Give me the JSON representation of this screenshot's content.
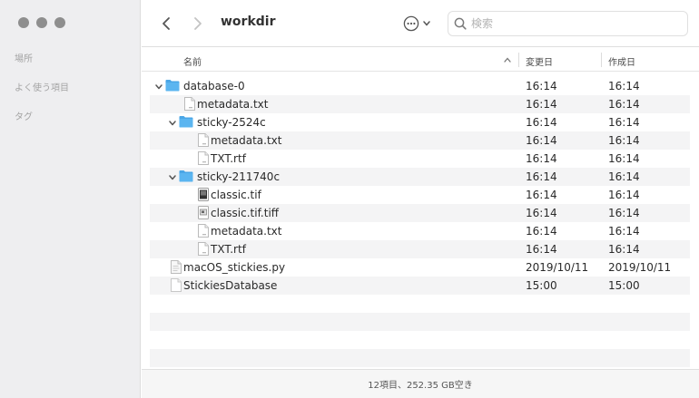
{
  "sidebar": {
    "sections": [
      "場所",
      "よく使う項目",
      "タグ"
    ]
  },
  "toolbar": {
    "title": "workdir",
    "search_placeholder": "検索"
  },
  "columns": {
    "name": "名前",
    "modified": "変更日",
    "created": "作成日"
  },
  "rows": [
    {
      "name": "database-0",
      "type": "folder",
      "level": 0,
      "expanded": true,
      "modified": "16:14",
      "created": "16:14"
    },
    {
      "name": "metadata.txt",
      "type": "text",
      "level": 1,
      "modified": "16:14",
      "created": "16:14"
    },
    {
      "name": "sticky-2524c",
      "type": "folder",
      "level": 1,
      "expanded": true,
      "modified": "16:14",
      "created": "16:14"
    },
    {
      "name": "metadata.txt",
      "type": "text",
      "level": 2,
      "modified": "16:14",
      "created": "16:14"
    },
    {
      "name": "TXT.rtf",
      "type": "text",
      "level": 2,
      "modified": "16:14",
      "created": "16:14"
    },
    {
      "name": "sticky-211740c",
      "type": "folder",
      "level": 1,
      "expanded": true,
      "modified": "16:14",
      "created": "16:14"
    },
    {
      "name": "classic.tif",
      "type": "image",
      "level": 2,
      "modified": "16:14",
      "created": "16:14"
    },
    {
      "name": "classic.tif.tiff",
      "type": "image-light",
      "level": 2,
      "modified": "16:14",
      "created": "16:14"
    },
    {
      "name": "metadata.txt",
      "type": "text",
      "level": 2,
      "modified": "16:14",
      "created": "16:14"
    },
    {
      "name": "TXT.rtf",
      "type": "text",
      "level": 2,
      "modified": "16:14",
      "created": "16:14"
    },
    {
      "name": "macOS_stickies.py",
      "type": "script",
      "level": 0,
      "modified": "2019/10/11",
      "created": "2019/10/11"
    },
    {
      "name": "StickiesDatabase",
      "type": "blank",
      "level": 0,
      "modified": "15:00",
      "created": "15:00"
    },
    {
      "name": "",
      "type": "empty",
      "level": 0,
      "modified": "",
      "created": ""
    },
    {
      "name": "",
      "type": "empty",
      "level": 0,
      "modified": "",
      "created": ""
    },
    {
      "name": "",
      "type": "empty",
      "level": 0,
      "modified": "",
      "created": ""
    },
    {
      "name": "",
      "type": "empty",
      "level": 0,
      "modified": "",
      "created": ""
    }
  ],
  "footer": {
    "status": "12項目、252.35 GB空き"
  },
  "colors": {
    "folder": "#5bb5f0",
    "folder_tab": "#4aa6e6"
  }
}
